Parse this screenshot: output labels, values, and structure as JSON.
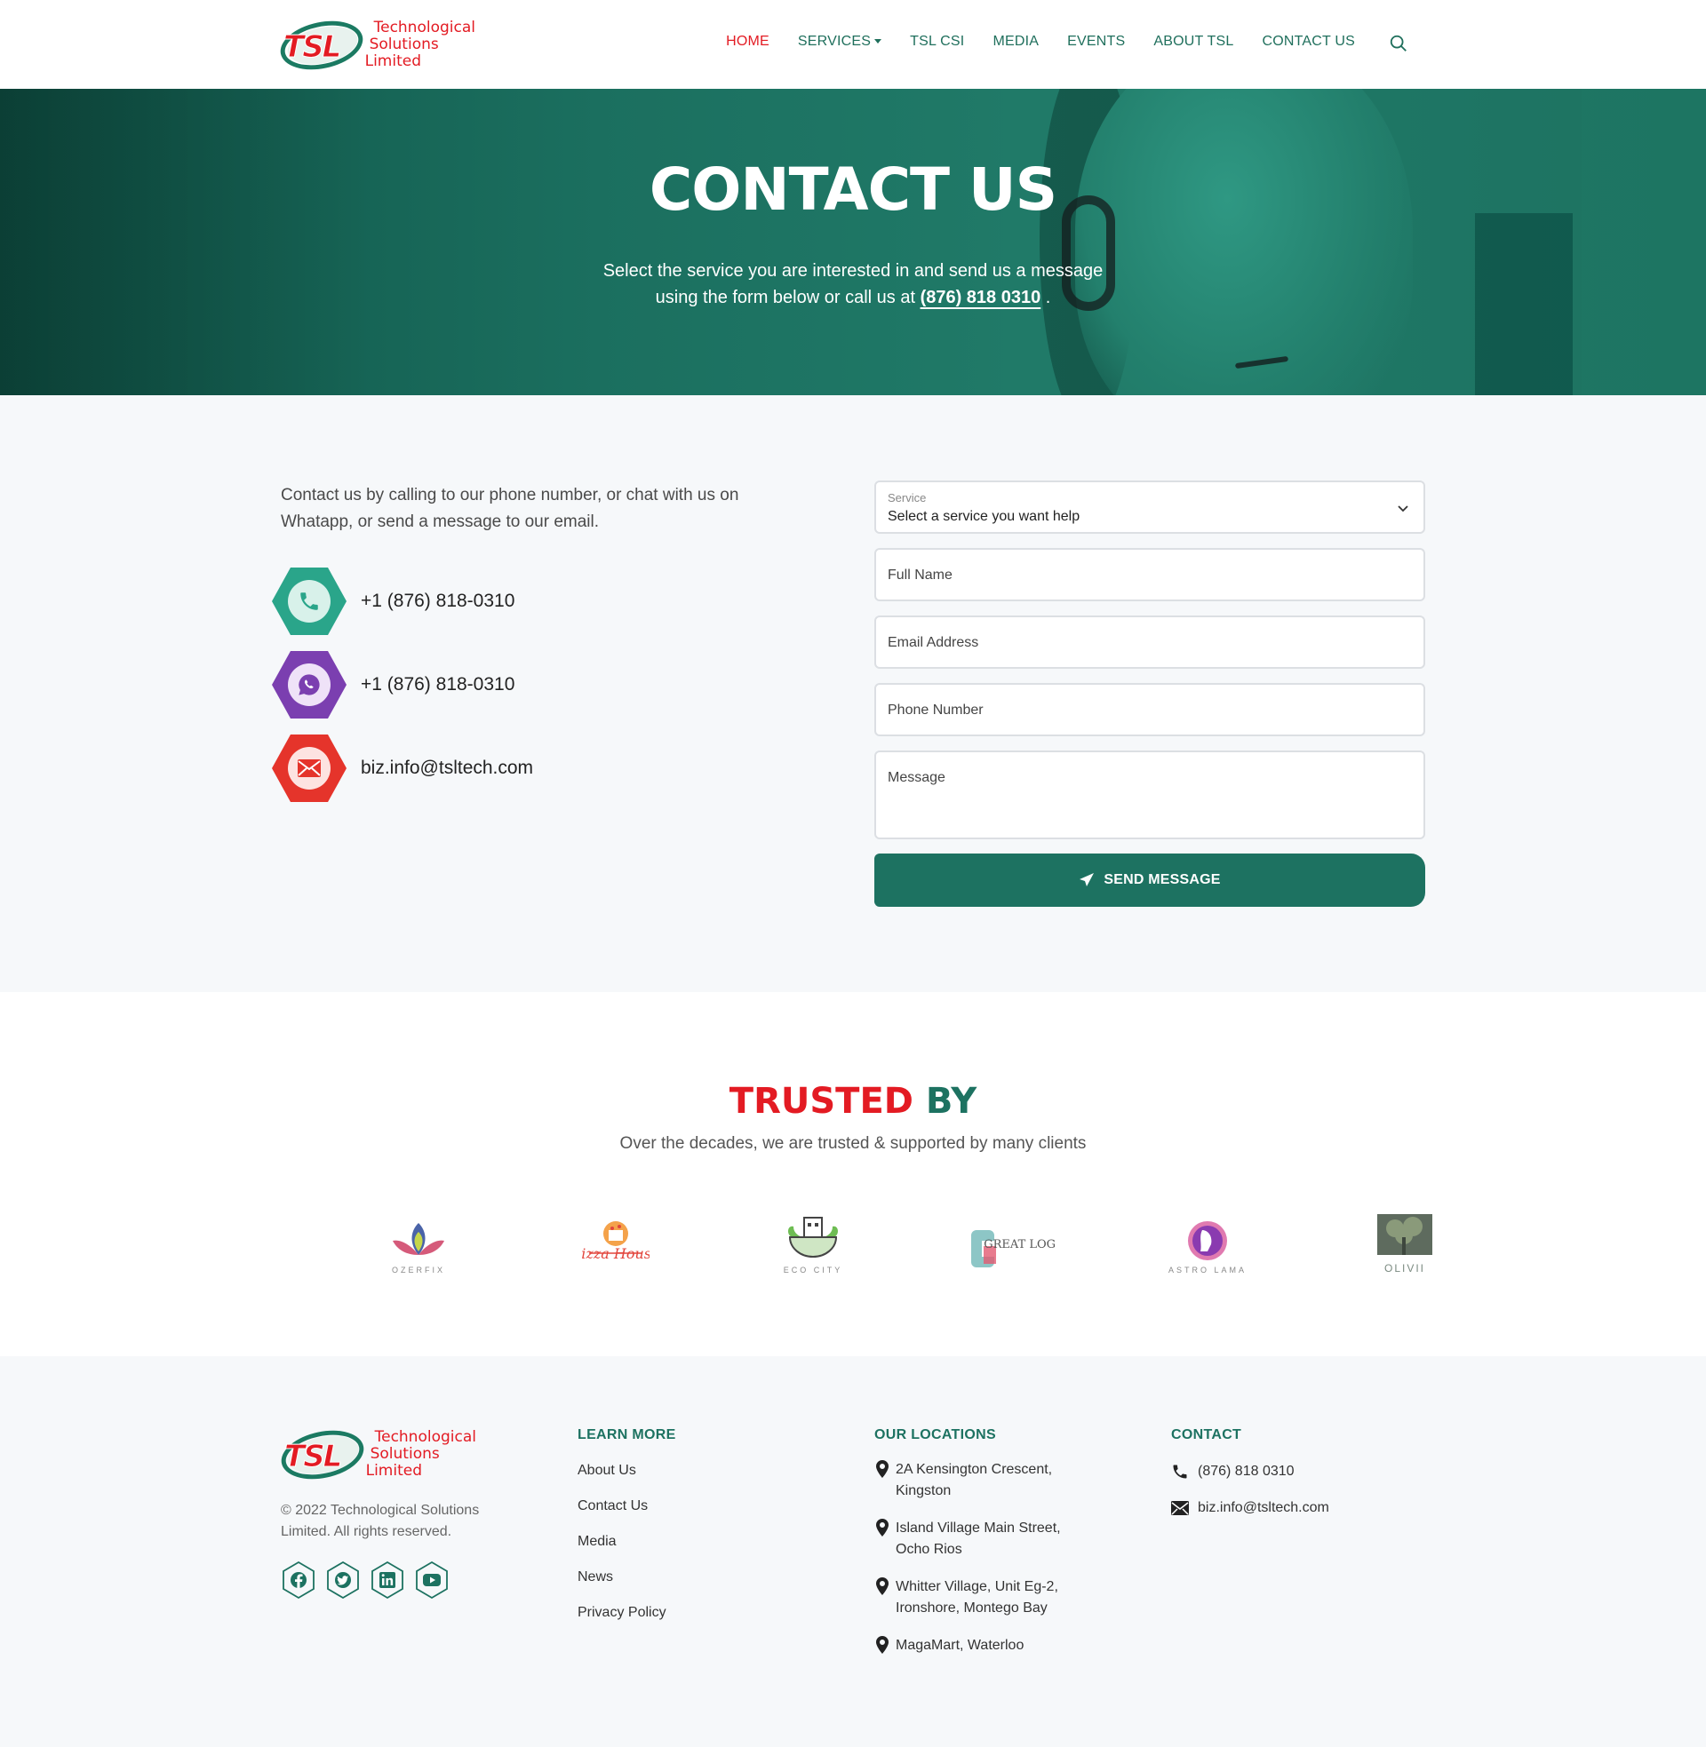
{
  "brand": {
    "logo_mark": "TSL",
    "logo_lines": [
      "Technological",
      "Solutions",
      "Limited"
    ]
  },
  "nav": {
    "items": [
      {
        "label": "HOME",
        "active": true
      },
      {
        "label": "SERVICES",
        "dropdown": true
      },
      {
        "label": "TSL CSI"
      },
      {
        "label": "MEDIA"
      },
      {
        "label": "EVENTS"
      },
      {
        "label": "ABOUT TSL"
      },
      {
        "label": "CONTACT US"
      }
    ],
    "search_icon": "search-icon"
  },
  "hero": {
    "title": "CONTACT US",
    "line1": "Select the service you are interested in and send us a message",
    "line2_prefix": "using the form below or call us at ",
    "phone": "(876) 818 0310",
    "line2_suffix": " ."
  },
  "contact": {
    "intro": "Contact us by calling to our phone number, or chat with us on Whatapp, or send a message to our email.",
    "items": [
      {
        "icon": "phone-icon",
        "value": "+1 (876) 818-0310",
        "color": "#2aa58a"
      },
      {
        "icon": "whatsapp-icon",
        "value": "+1 (876) 818-0310",
        "color": "#7b3fb0"
      },
      {
        "icon": "mail-icon",
        "value": "biz.info@tsltech.com",
        "color": "#e5342b"
      }
    ]
  },
  "form": {
    "service_label": "Service",
    "service_value": "Select a service you want help",
    "full_name": "Full Name",
    "email": "Email Address",
    "phone": "Phone Number",
    "message": "Message",
    "submit": "SEND MESSAGE"
  },
  "trusted": {
    "title_red": "TRUSTED",
    "title_green": "BY",
    "subtitle": "Over the decades, we are trusted & supported by many clients",
    "clients": [
      "OZERFIX",
      "Pizza House",
      "ECO CITY",
      "GREAT LOGO",
      "ASTRO LAMA",
      "OLIVII"
    ]
  },
  "footer": {
    "copyright": "© 2022 Technological Solutions Limited. All rights reserved.",
    "social": [
      "facebook-icon",
      "twitter-icon",
      "linkedin-icon",
      "youtube-icon"
    ],
    "learn_more": {
      "heading": "LEARN MORE",
      "links": [
        "About Us",
        "Contact Us",
        "Media",
        "News",
        "Privacy Policy"
      ]
    },
    "locations": {
      "heading": "OUR LOCATIONS",
      "items": [
        "2A Kensington Crescent, Kingston",
        "Island Village Main Street, Ocho Rios",
        "Whitter Village, Unit Eg-2, Ironshore, Montego Bay",
        "MagaMart, Waterloo"
      ]
    },
    "contact": {
      "heading": "CONTACT",
      "phone": "(876) 818 0310",
      "email": "biz.info@tsltech.com"
    }
  },
  "colors": {
    "brand_green": "#1d7261",
    "brand_red": "#e31b23",
    "section_bg": "#f6f8fa"
  }
}
